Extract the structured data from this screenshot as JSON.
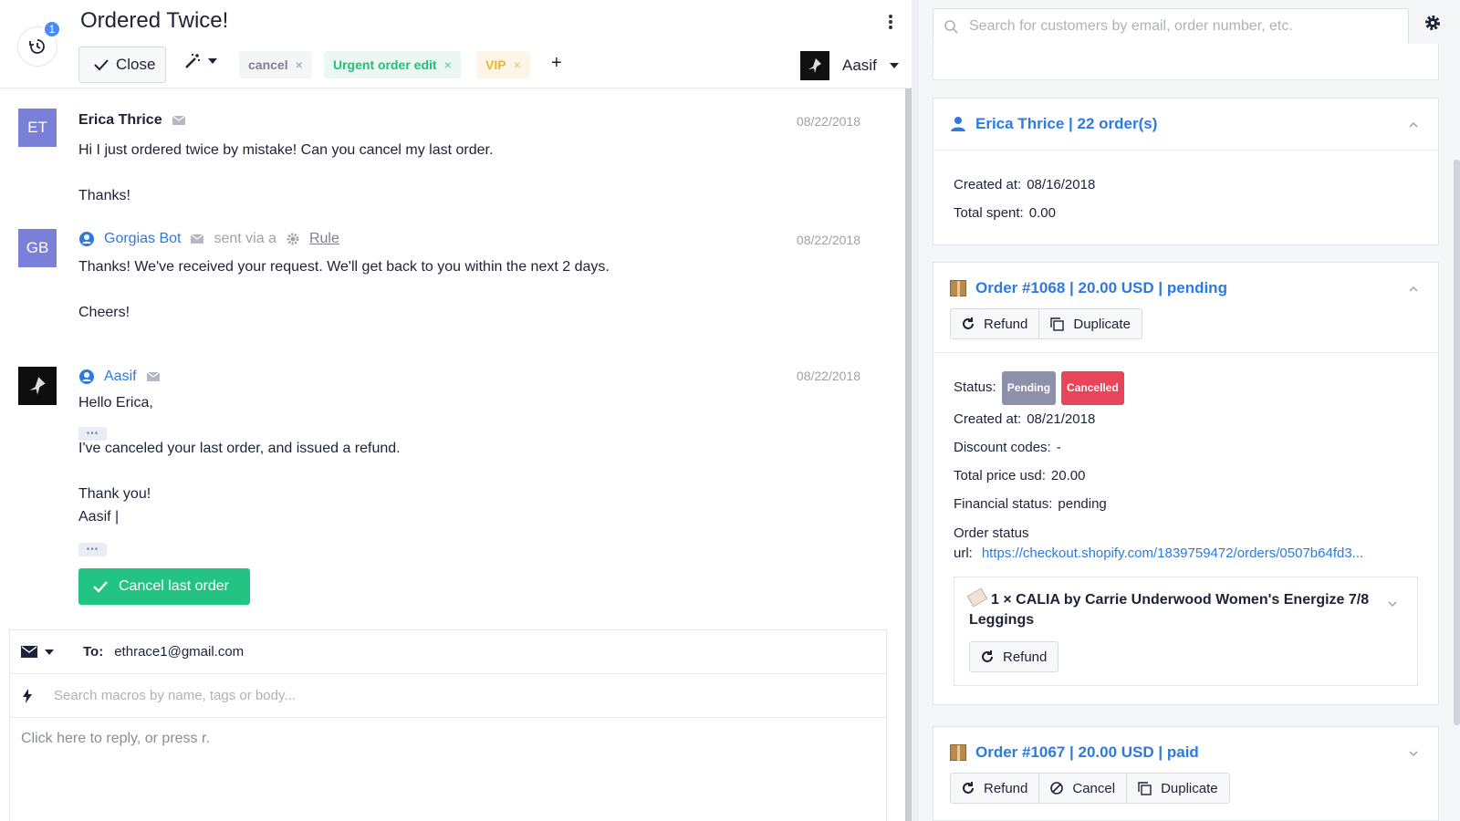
{
  "header": {
    "title": "Ordered Twice!",
    "history_count": "1",
    "close_label": "Close",
    "tags": [
      {
        "label": "cancel",
        "remove": "×"
      },
      {
        "label": "Urgent order edit",
        "remove": "×"
      },
      {
        "label": "VIP",
        "remove": "×"
      }
    ],
    "add_tag": "+",
    "assignee": "Aasif"
  },
  "messages": [
    {
      "initials": "ET",
      "name": "Erica Thrice",
      "date": "08/22/2018",
      "body": "Hi I just ordered twice by mistake! Can you cancel my last order.\n\nThanks!"
    },
    {
      "initials": "GB",
      "name": "Gorgias Bot",
      "via": "sent via a",
      "rule": "Rule",
      "date": "08/22/2018",
      "body": "Thanks! We've received your request. We'll get back to you within the next 2 days.\n\nCheers!",
      "dots": "•••"
    },
    {
      "name": "Aasif",
      "date": "08/22/2018",
      "body": "Hello Erica,\n\nI've canceled your last order, and issued a refund.\n\nThank you!\nAasif |",
      "dots": "•••"
    }
  ],
  "action_button": "Cancel last order",
  "reply": {
    "to_label": "To:",
    "to_value": "ethrace1@gmail.com",
    "macro_placeholder": "Search macros by name, tags or body...",
    "reply_placeholder": "Click here to reply, or press r."
  },
  "sidebar": {
    "search_placeholder": "Search for customers by email, order number, etc.",
    "customer": {
      "title": "Erica Thrice | 22 order(s)",
      "created_label": "Created at:",
      "created_value": "08/16/2018",
      "spent_label": "Total spent:",
      "spent_value": "0.00"
    },
    "order1": {
      "title": "Order #1068 | 20.00 USD | pending",
      "refund": "Refund",
      "duplicate": "Duplicate",
      "status_label": "Status:",
      "status_pending": "Pending",
      "status_cancelled": "Cancelled",
      "created_label": "Created at:",
      "created_value": "08/21/2018",
      "discount_label": "Discount codes:",
      "discount_value": "-",
      "total_label": "Total price usd:",
      "total_value": "20.00",
      "financial_label": "Financial status:",
      "financial_value": "pending",
      "url_label_1": "Order status",
      "url_label_2": "url:",
      "url_value": "https://checkout.shopify.com/1839759472/orders/0507b64fd3...",
      "item_title": "1 × CALIA by Carrie Underwood Women's Energize 7/8 Leggings",
      "item_refund": "Refund"
    },
    "order2": {
      "title": "Order #1067 | 20.00 USD | paid",
      "refund": "Refund",
      "cancel": "Cancel",
      "duplicate": "Duplicate"
    }
  }
}
